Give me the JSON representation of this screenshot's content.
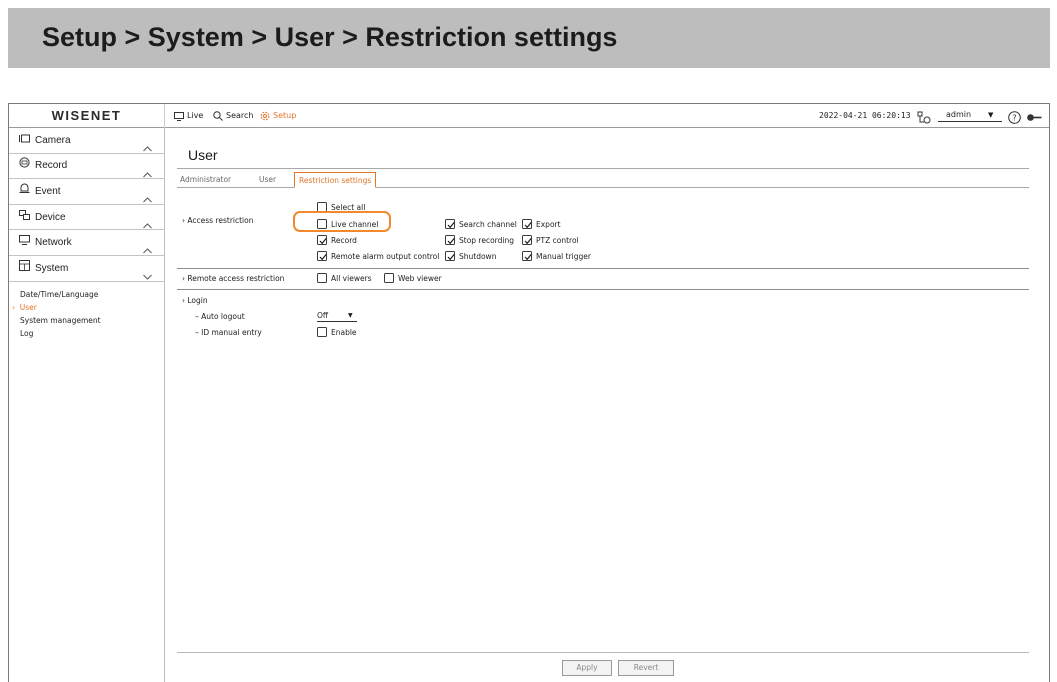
{
  "banner": {
    "title": "Setup > System > User > Restriction settings"
  },
  "topbar": {
    "logo": "WISENET",
    "nav": {
      "live": "Live",
      "search": "Search",
      "setup": "Setup"
    },
    "datetime": "2022-04-21 06:20:13",
    "user": "admin"
  },
  "sidebar": {
    "menus": [
      {
        "label": "Camera",
        "icon": "camera-icon",
        "expanded": false
      },
      {
        "label": "Record",
        "icon": "record-icon",
        "expanded": false
      },
      {
        "label": "Event",
        "icon": "bell-icon",
        "expanded": false
      },
      {
        "label": "Device",
        "icon": "device-icon",
        "expanded": false
      },
      {
        "label": "Network",
        "icon": "monitor-icon",
        "expanded": false
      },
      {
        "label": "System",
        "icon": "system-icon",
        "expanded": true
      }
    ],
    "system_items": [
      "Date/Time/Language",
      "User",
      "System management",
      "Log"
    ],
    "active_item": "User"
  },
  "main": {
    "page_title": "User",
    "tabs": [
      "Administrator",
      "User",
      "Restriction settings"
    ],
    "active_tab": "Restriction settings",
    "access_restriction": {
      "label": "Access restriction",
      "select_all": {
        "label": "Select all",
        "checked": false
      },
      "options": [
        {
          "label": "Live channel",
          "checked": false,
          "highlighted": true
        },
        {
          "label": "Search channel",
          "checked": true
        },
        {
          "label": "Export",
          "checked": true
        },
        {
          "label": "Record",
          "checked": true
        },
        {
          "label": "Stop recording",
          "checked": true
        },
        {
          "label": "PTZ control",
          "checked": true
        },
        {
          "label": "Remote alarm output control",
          "checked": true
        },
        {
          "label": "Shutdown",
          "checked": true
        },
        {
          "label": "Manual trigger",
          "checked": true
        }
      ]
    },
    "remote_access": {
      "label": "Remote access restriction",
      "options": [
        {
          "label": "All viewers",
          "checked": false
        },
        {
          "label": "Web viewer",
          "checked": false
        }
      ]
    },
    "login": {
      "label": "Login",
      "auto_logout": {
        "label": "– Auto logout",
        "value": "Off"
      },
      "id_manual_entry": {
        "label": "– ID manual entry",
        "option": "Enable",
        "checked": false
      }
    },
    "buttons": {
      "apply": "Apply",
      "revert": "Revert"
    }
  },
  "colors": {
    "accent": "#e2762a",
    "highlight": "#f08a2c",
    "banner": "#bdbdbd"
  }
}
